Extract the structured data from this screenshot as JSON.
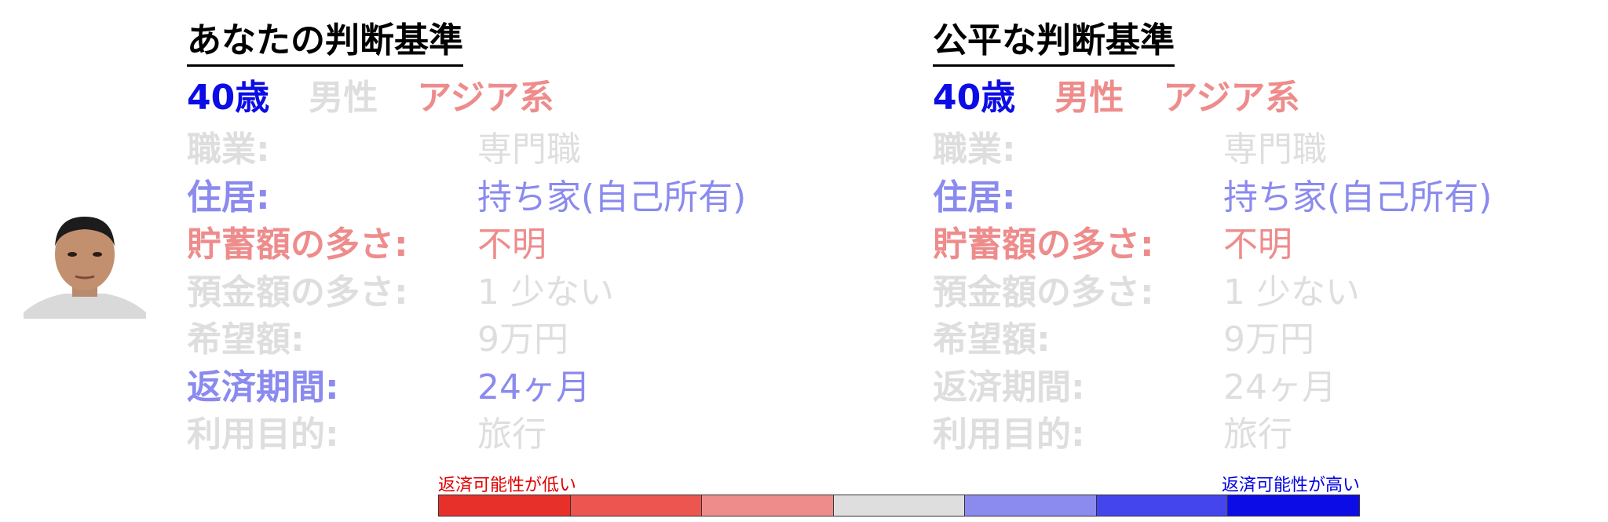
{
  "colors": {
    "blue_strong": "#0c0ce6",
    "blue_mid": "#8a8aef",
    "red_mid": "#ee8c8c",
    "gray": "#dedede",
    "black": "#000000"
  },
  "left_panel": {
    "title": "あなたの判断基準",
    "demographics": [
      {
        "text": "40歳",
        "color": "#0c0ce6"
      },
      {
        "text": "男性",
        "color": "#dedede"
      },
      {
        "text": "アジア系",
        "color": "#ee8c8c"
      }
    ],
    "rows": [
      {
        "label": "職業:",
        "value": "専門職",
        "color": "#dedede"
      },
      {
        "label": "住居:",
        "value": "持ち家(自己所有)",
        "color": "#8a8aef"
      },
      {
        "label": "貯蓄額の多さ:",
        "value": "不明",
        "color": "#ee8c8c"
      },
      {
        "label": "預金額の多さ:",
        "value": "1 少ない",
        "color": "#dedede"
      },
      {
        "label": "希望額:",
        "value": "9万円",
        "color": "#dedede"
      },
      {
        "label": "返済期間:",
        "value": "24ヶ月",
        "color": "#8a8aef"
      },
      {
        "label": "利用目的:",
        "value": "旅行",
        "color": "#dedede"
      }
    ]
  },
  "right_panel": {
    "title": "公平な判断基準",
    "demographics": [
      {
        "text": "40歳",
        "color": "#0c0ce6"
      },
      {
        "text": "男性",
        "color": "#ee8c8c"
      },
      {
        "text": "アジア系",
        "color": "#ee8c8c"
      }
    ],
    "rows": [
      {
        "label": "職業:",
        "value": "専門職",
        "color": "#dedede"
      },
      {
        "label": "住居:",
        "value": "持ち家(自己所有)",
        "color": "#8a8aef"
      },
      {
        "label": "貯蓄額の多さ:",
        "value": "不明",
        "color": "#ee8c8c"
      },
      {
        "label": "預金額の多さ:",
        "value": "1 少ない",
        "color": "#dedede"
      },
      {
        "label": "希望額:",
        "value": "9万円",
        "color": "#dedede"
      },
      {
        "label": "返済期間:",
        "value": "24ヶ月",
        "color": "#dedede"
      },
      {
        "label": "利用目的:",
        "value": "旅行",
        "color": "#dedede"
      }
    ]
  },
  "legend": {
    "low_label": "返済可能性が低い",
    "high_label": "返済可能性が高い",
    "low_color": "#e00000",
    "high_color": "#0000e0",
    "scale": [
      "#e8302a",
      "#ec5550",
      "#ee8c8c",
      "#dedede",
      "#8a8aef",
      "#4545ee",
      "#0c0ce6"
    ]
  }
}
